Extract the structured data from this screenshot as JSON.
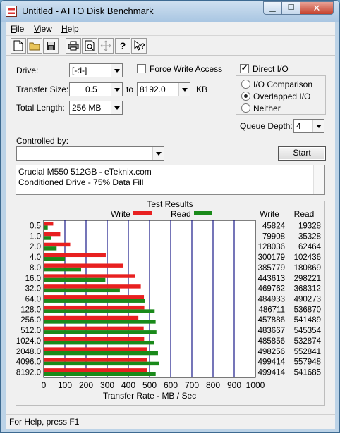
{
  "window": {
    "title": "Untitled - ATTO Disk Benchmark"
  },
  "menu": {
    "file": "File",
    "view": "View",
    "help": "Help"
  },
  "toolbar": {
    "buttons": [
      {
        "name": "new-icon",
        "glyph": "🗋"
      },
      {
        "name": "open-icon",
        "glyph": "📂"
      },
      {
        "name": "save-icon",
        "glyph": "💾"
      },
      {
        "name": "print-icon",
        "glyph": "🖨"
      },
      {
        "name": "print-preview-icon",
        "glyph": "🔍"
      },
      {
        "name": "move-icon",
        "glyph": "✥"
      },
      {
        "name": "help-icon",
        "glyph": "?"
      },
      {
        "name": "context-help-icon",
        "glyph": "?"
      }
    ]
  },
  "form": {
    "drive_label": "Drive:",
    "drive_value": "[-d-]",
    "force_write_label": "Force Write Access",
    "force_write_checked": false,
    "direct_io_label": "Direct I/O",
    "direct_io_checked": true,
    "transfer_size_label": "Transfer Size:",
    "transfer_from": "0.5",
    "to_label": "to",
    "transfer_to": "8192.0",
    "kb_label": "KB",
    "total_length_label": "Total Length:",
    "total_length_value": "256 MB",
    "io_comparison_label": "I/O Comparison",
    "overlapped_io_label": "Overlapped I/O",
    "neither_label": "Neither",
    "io_mode_selected": "Overlapped I/O",
    "queue_depth_label": "Queue Depth:",
    "queue_depth_value": "4",
    "controlled_by_label": "Controlled by:",
    "controlled_by_value": "",
    "start_label": "Start",
    "description_line1": "Crucial M550 512GB - eTeknix.com",
    "description_line2": "Conditioned Drive - 75% Data Fill"
  },
  "results": {
    "title": "Test Results",
    "legend_write": "Write",
    "legend_read": "Read",
    "col_write": "Write",
    "col_read": "Read",
    "x_axis_label": "Transfer Rate - MB / Sec",
    "write_color": "#e82020",
    "read_color": "#1a8a1a",
    "grid_color": "#1a1a8a"
  },
  "chart_data": {
    "type": "bar",
    "orientation": "horizontal",
    "title": "Test Results",
    "xlabel": "Transfer Rate - MB / Sec",
    "xlim": [
      0,
      1000
    ],
    "xticks": [
      0,
      100,
      200,
      300,
      400,
      500,
      600,
      700,
      800,
      900,
      1000
    ],
    "categories": [
      "0.5",
      "1.0",
      "2.0",
      "4.0",
      "8.0",
      "16.0",
      "32.0",
      "64.0",
      "128.0",
      "256.0",
      "512.0",
      "1024.0",
      "2048.0",
      "4096.0",
      "8192.0"
    ],
    "series": [
      {
        "name": "Write",
        "values": [
          45824,
          79908,
          128036,
          300179,
          385779,
          443613,
          469762,
          484933,
          486711,
          457886,
          483667,
          485856,
          498256,
          499414,
          499414
        ]
      },
      {
        "name": "Read",
        "values": [
          19328,
          35328,
          62464,
          102436,
          180869,
          298221,
          368312,
          490273,
          536870,
          541489,
          545354,
          532874,
          552841,
          557948,
          541685
        ]
      }
    ],
    "value_units": "KB/s",
    "legend_position": "top"
  },
  "status": {
    "text": "For Help, press F1"
  }
}
